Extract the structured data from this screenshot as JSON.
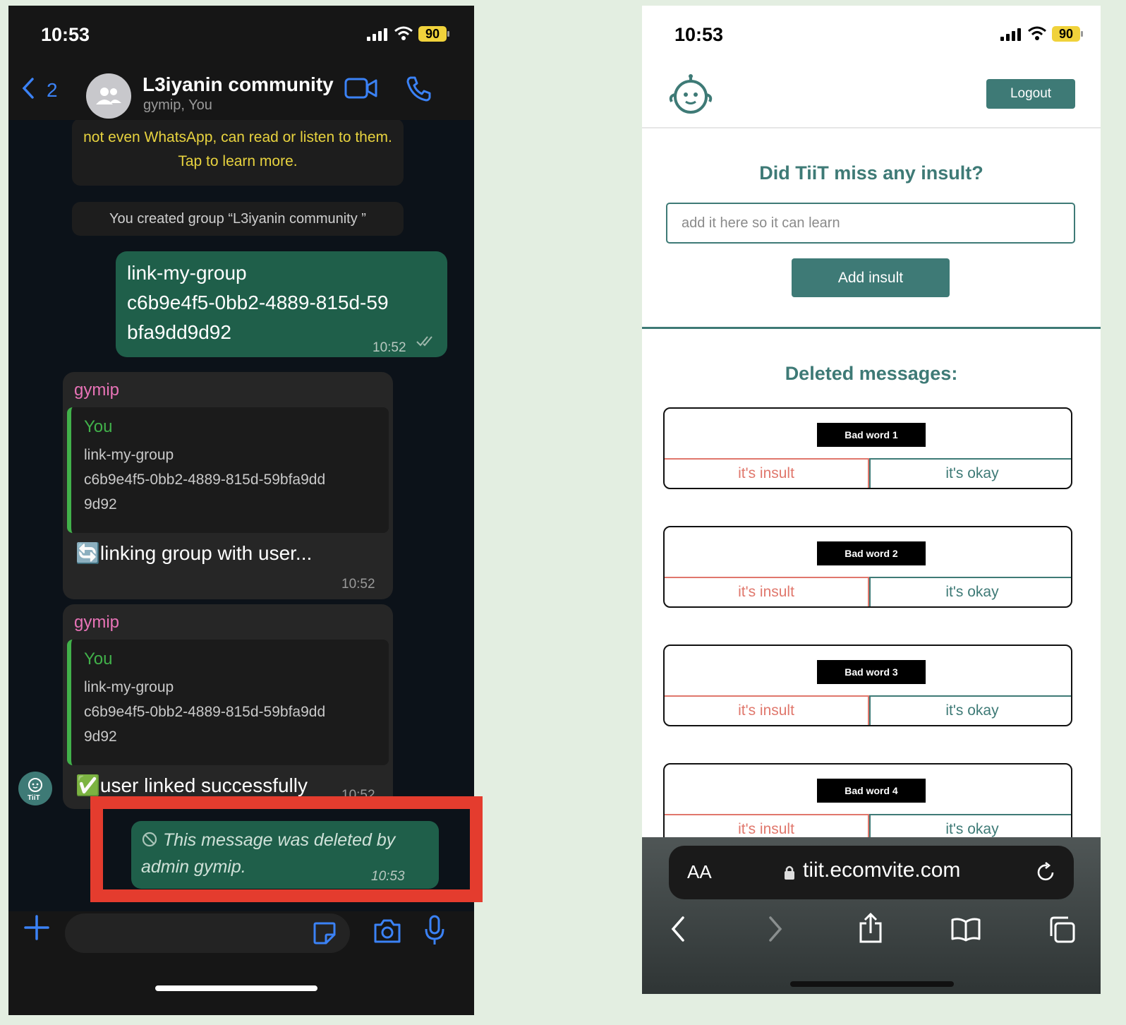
{
  "whatsapp": {
    "status": {
      "time": "10:53",
      "battery": "90"
    },
    "header": {
      "back_count": "2",
      "title": "L3iyanin community",
      "subtitle": "gymip, You"
    },
    "encryption_notice": "not even WhatsApp, can read or listen to them. Tap to learn more.",
    "created_notice": "You created group “L3iyanin community ”",
    "outgoing_message": {
      "lines": [
        "link-my-group",
        "c6b9e4f5-0bb2-4889-815d-59",
        "bfa9dd9d92"
      ],
      "time": "10:52"
    },
    "reply1": {
      "sender": "gymip",
      "quoted_author": "You",
      "quoted_lines": [
        "link-my-group",
        "c6b9e4f5-0bb2-4889-815d-59bfa9dd",
        "9d92"
      ],
      "text": "linking group with user...",
      "emoji": "🔄",
      "time": "10:52"
    },
    "reply2": {
      "sender": "gymip",
      "quoted_author": "You",
      "quoted_lines": [
        "link-my-group",
        "c6b9e4f5-0bb2-4889-815d-59bfa9dd",
        "9d92"
      ],
      "text": "user linked successfully",
      "emoji": "✅",
      "time": "10:52"
    },
    "avatar_label": "TiiT",
    "deleted_message": {
      "text": "This message was deleted by admin gymip.",
      "time": "10:53"
    }
  },
  "safari": {
    "status": {
      "time": "10:53",
      "battery": "90"
    },
    "logout_label": "Logout",
    "form": {
      "heading": "Did TiiT miss any insult?",
      "placeholder": "add it here so it can learn",
      "button": "Add insult"
    },
    "deleted_heading": "Deleted messages:",
    "cards": [
      {
        "word": "Bad word 1",
        "insult": "it's insult",
        "okay": "it's okay"
      },
      {
        "word": "Bad word 2",
        "insult": "it's insult",
        "okay": "it's okay"
      },
      {
        "word": "Bad word 3",
        "insult": "it's insult",
        "okay": "it's okay"
      },
      {
        "word": "Bad word 4",
        "insult": "it's insult",
        "okay": "it's okay"
      }
    ],
    "url_bar": {
      "aa": "AA",
      "url": "tiit.ecomvite.com"
    }
  },
  "colors": {
    "teal": "#3e7a76",
    "insult_red": "#e0776c",
    "wa_outgoing": "#1f5f4a",
    "highlight_red": "#e43c2e",
    "wa_blue": "#3b82f6"
  }
}
